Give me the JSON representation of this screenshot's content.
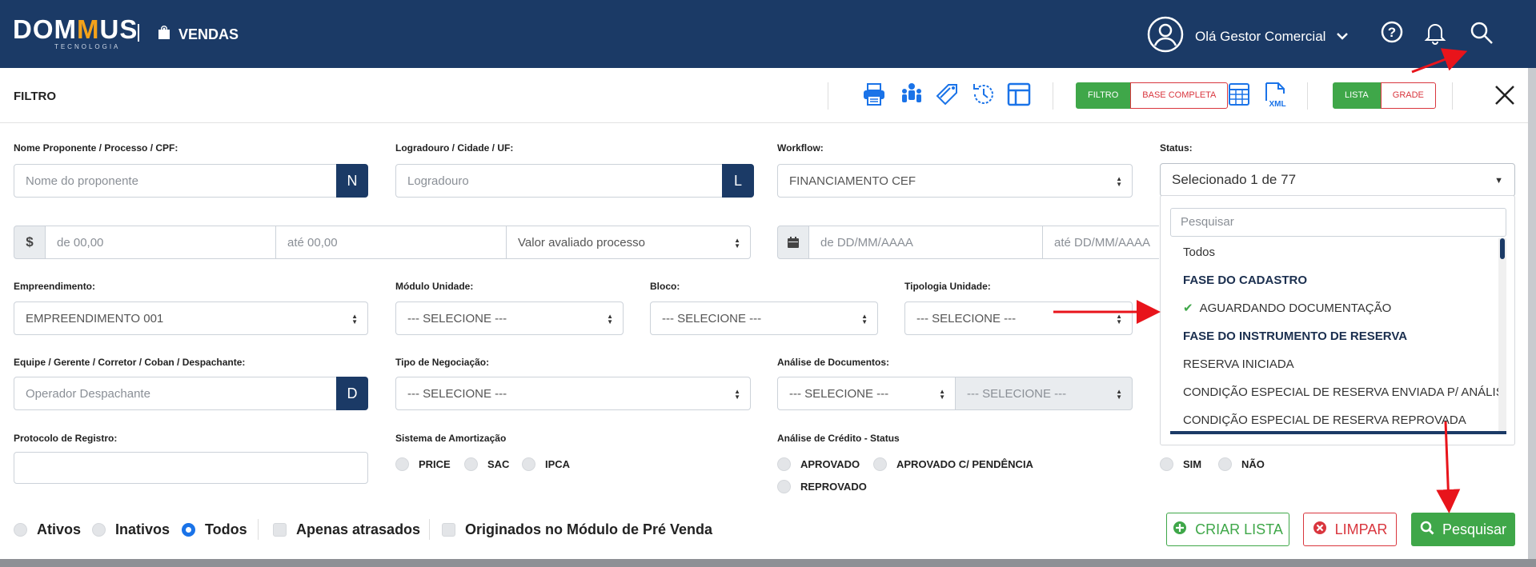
{
  "header": {
    "logo_text_a": "DOM",
    "logo_text_m": "M",
    "logo_text_b": "US",
    "logo_sub": "TECNOLOGIA",
    "module": "VENDAS",
    "greeting": "Olá Gestor Comercial"
  },
  "filterbar": {
    "title": "FILTRO",
    "filtro": "FILTRO",
    "base_completa": "BASE COMPLETA",
    "xml": "XML",
    "lista": "LISTA",
    "grade": "GRADE"
  },
  "form": {
    "nome_label": "Nome Proponente / Processo / CPF:",
    "nome_placeholder": "Nome do proponente",
    "nome_addon": "N",
    "logradouro_label": "Logradouro / Cidade / UF:",
    "logradouro_placeholder": "Logradouro",
    "logradouro_addon": "L",
    "workflow_label": "Workflow:",
    "workflow_value": "FINANCIAMENTO CEF",
    "status_label": "Status:",
    "status_value": "Selecionado 1 de 77",
    "currency_addon": "$",
    "valor_de": "de  00,00",
    "valor_ate": "até  00,00",
    "valor_tipo": "Valor avaliado processo",
    "data_de": "de  DD/MM/AAAA",
    "data_ate": "até  DD/MM/AAAA",
    "empreendimento_label": "Empreendimento:",
    "empreendimento_value": "EMPREENDIMENTO 001",
    "modulo_label": "Módulo Unidade:",
    "bloco_label": "Bloco:",
    "tipologia_label": "Tipologia Unidade:",
    "selecione": "--- SELECIONE ---",
    "equipe_label": "Equipe / Gerente / Corretor / Coban / Despachante:",
    "equipe_placeholder": "Operador Despachante",
    "equipe_addon": "D",
    "negociacao_label": "Tipo de Negociação:",
    "analise_doc_label": "Análise de Documentos:",
    "protocolo_label": "Protocolo de Registro:",
    "amortizacao_label": "Sistema de Amortização",
    "amortizacao_opts": [
      "PRICE",
      "SAC",
      "IPCA"
    ],
    "credito_label": "Análise de Crédito - Status",
    "credito_opts": [
      "APROVADO",
      "APROVADO C/ PENDÊNCIA",
      "REPROVADO"
    ],
    "simnao_opts": [
      "SIM",
      "NÃO"
    ]
  },
  "status_dropdown": {
    "search_placeholder": "Pesquisar",
    "items": [
      {
        "label": "Todos",
        "group": false,
        "checked": false
      },
      {
        "label": "FASE DO CADASTRO",
        "group": true,
        "checked": false
      },
      {
        "label": "AGUARDANDO DOCUMENTAÇÃO",
        "group": false,
        "checked": true
      },
      {
        "label": "FASE DO INSTRUMENTO DE RESERVA",
        "group": true,
        "checked": false
      },
      {
        "label": "RESERVA INICIADA",
        "group": false,
        "checked": false
      },
      {
        "label": "CONDIÇÃO ESPECIAL DE RESERVA ENVIADA P/ ANÁLISE",
        "group": false,
        "checked": false
      },
      {
        "label": "CONDIÇÃO ESPECIAL DE RESERVA REPROVADA",
        "group": false,
        "checked": false
      }
    ]
  },
  "bottom": {
    "ativos": "Ativos",
    "inativos": "Inativos",
    "todos": "Todos",
    "atrasados": "Apenas atrasados",
    "pre_venda": "Originados no Módulo de Pré Venda",
    "criar_lista": "CRIAR LISTA",
    "limpar": "LIMPAR",
    "pesquisar": "Pesquisar"
  },
  "colors": {
    "navy": "#1b3a66",
    "green": "#3fa749",
    "red": "#d9363e",
    "accent_orange": "#f3a21a",
    "annotation_arrow": "#e8141b"
  }
}
